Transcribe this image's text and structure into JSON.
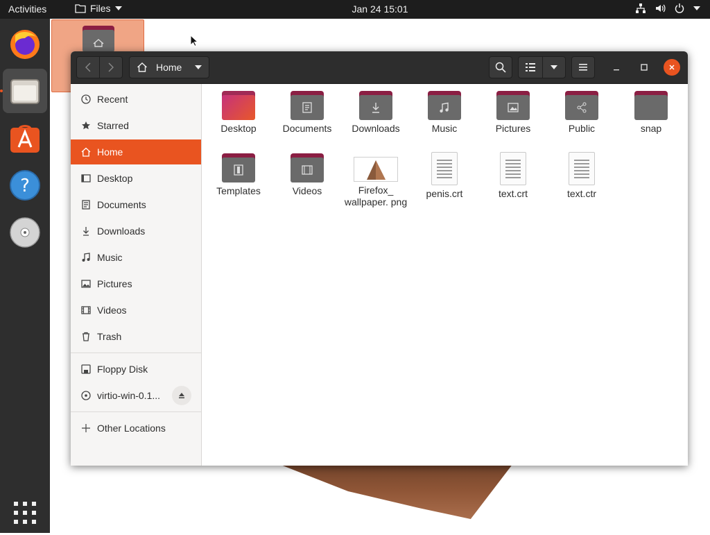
{
  "topbar": {
    "activities": "Activities",
    "app_name": "Files",
    "clock": "Jan 24  15:01",
    "tray_icons": [
      "network-icon",
      "volume-icon",
      "power-icon"
    ]
  },
  "dock": {
    "items": [
      {
        "name": "firefox-icon"
      },
      {
        "name": "files-icon",
        "active": true
      },
      {
        "name": "software-icon"
      },
      {
        "name": "help-icon"
      },
      {
        "name": "disc-icon"
      },
      {
        "name": "app-grid-icon"
      }
    ]
  },
  "window": {
    "path_label": "Home",
    "sidebar": {
      "items": [
        {
          "label": "Recent",
          "icon": "clock-icon"
        },
        {
          "label": "Starred",
          "icon": "star-icon"
        },
        {
          "label": "Home",
          "icon": "home-icon",
          "active": true
        },
        {
          "label": "Desktop",
          "icon": "desktop-icon"
        },
        {
          "label": "Documents",
          "icon": "document-icon"
        },
        {
          "label": "Downloads",
          "icon": "download-icon"
        },
        {
          "label": "Music",
          "icon": "music-icon"
        },
        {
          "label": "Pictures",
          "icon": "picture-icon"
        },
        {
          "label": "Videos",
          "icon": "video-icon"
        },
        {
          "label": "Trash",
          "icon": "trash-icon"
        }
      ],
      "devices": [
        {
          "label": "Floppy Disk",
          "icon": "floppy-icon"
        },
        {
          "label": "virtio-win-0.1...",
          "icon": "disc-icon"
        }
      ],
      "other": {
        "label": "Other Locations",
        "icon": "plus-icon"
      }
    },
    "files": [
      {
        "label": "Desktop",
        "kind": "folder-desktop"
      },
      {
        "label": "Documents",
        "kind": "folder-documents"
      },
      {
        "label": "Downloads",
        "kind": "folder-downloads"
      },
      {
        "label": "Music",
        "kind": "folder-music"
      },
      {
        "label": "Pictures",
        "kind": "folder-pictures"
      },
      {
        "label": "Public",
        "kind": "folder-public"
      },
      {
        "label": "snap",
        "kind": "folder"
      },
      {
        "label": "Templates",
        "kind": "folder-templates"
      },
      {
        "label": "Videos",
        "kind": "folder-videos"
      },
      {
        "label": "Firefox_ wallpaper. png",
        "kind": "image"
      },
      {
        "label": "penis.crt",
        "kind": "text"
      },
      {
        "label": "text.crt",
        "kind": "text"
      },
      {
        "label": "text.ctr",
        "kind": "text"
      }
    ]
  },
  "colors": {
    "accent": "#e95420",
    "folder_tab": "#8b1e43",
    "headerbar": "#2d2d2d"
  }
}
